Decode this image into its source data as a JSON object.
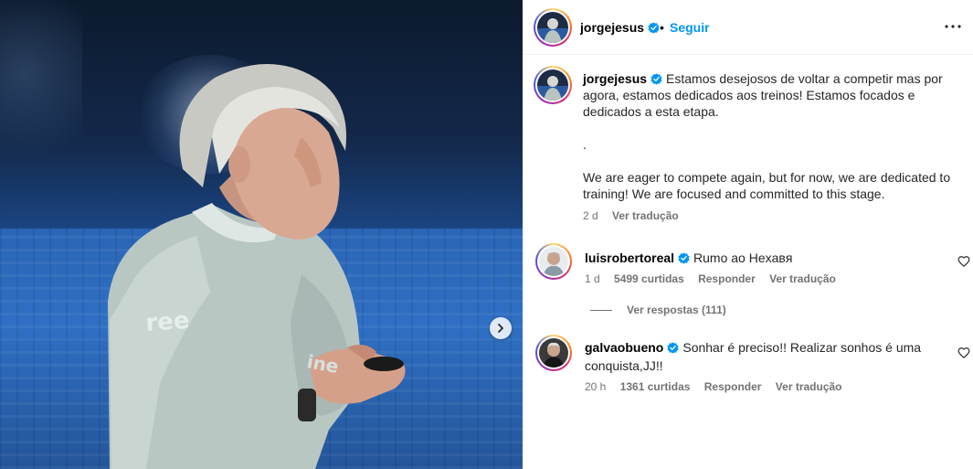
{
  "post": {
    "author": "jorgejesus",
    "follow_label": "Seguir",
    "separator": "•",
    "more_icon": "more-horizontal-icon"
  },
  "caption": {
    "username": "jorgejesus",
    "text_pt": "Estamos desejosos de voltar a competir mas por agora, estamos dedicados aos treinos! Estamos focados e dedicados a esta etapa.",
    "dot": ".",
    "text_en": "We are eager to compete again, but for now, we are dedicated to training! We are focused and committed to this stage.",
    "time": "2 d",
    "translate_label": "Ver tradução"
  },
  "comments": [
    {
      "username": "luisrobertoreal",
      "text": "Rumo ao Hexaвᴙ",
      "time": "1 d",
      "likes": "5499 curtidas",
      "reply_label": "Responder",
      "translate_label": "Ver tradução",
      "view_replies": "Ver respostas (111)"
    },
    {
      "username": "galvaobueno",
      "text": "Sonhar é preciso!! Realizar sonhos é uma conquista,JJ!!",
      "time": "20 h",
      "likes": "1361 curtidas",
      "reply_label": "Responder",
      "translate_label": "Ver tradução"
    }
  ],
  "colors": {
    "accent": "#0095f6",
    "verified": "#0095f6",
    "muted": "#737373"
  }
}
